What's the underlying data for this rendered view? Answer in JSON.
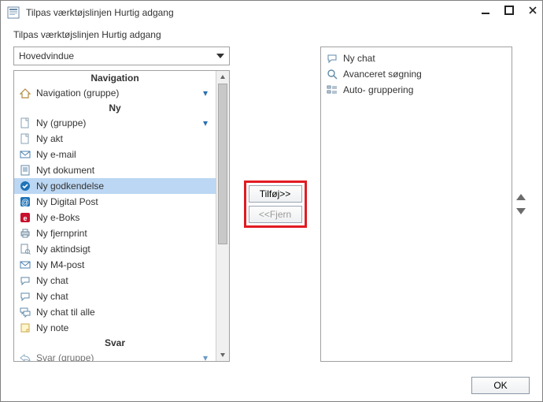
{
  "window": {
    "title": "Tilpas værktøjslinjen Hurtig adgang",
    "subtitle": "Tilpas værktøjslinjen Hurtig adgang"
  },
  "combo": {
    "selected": "Hovedvindue"
  },
  "groups": {
    "navigation": "Navigation",
    "ny": "Ny",
    "svar": "Svar"
  },
  "left": {
    "nav_group_item": "Navigation (gruppe)",
    "ny_group_item": "Ny (gruppe)",
    "ny_akt": "Ny akt",
    "ny_email": "Ny e-mail",
    "nyt_dokument": "Nyt dokument",
    "ny_godkendelse": "Ny godkendelse",
    "ny_digital_post": "Ny Digital Post",
    "ny_eboks": "Ny e-Boks",
    "ny_fjernprint": "Ny fjernprint",
    "ny_aktindsigt": "Ny aktindsigt",
    "ny_m4post": "Ny M4-post",
    "ny_chat": "Ny chat",
    "ny_chat2": "Ny chat",
    "ny_chat_alle": "Ny chat til alle",
    "ny_note": "Ny note",
    "svar_group_item": "Svar (gruppe)"
  },
  "buttons": {
    "add": "Tilføj>>",
    "remove": "<<Fjern",
    "ok": "OK"
  },
  "right": {
    "ny_chat": "Ny chat",
    "adv_search": "Avanceret søgning",
    "auto_group": "Auto- gruppering"
  }
}
